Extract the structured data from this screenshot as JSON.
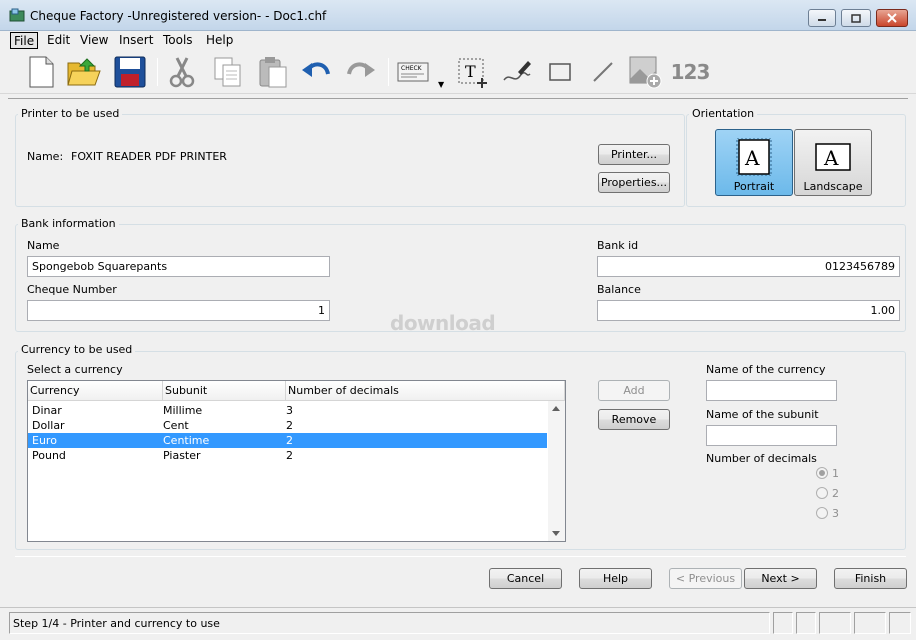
{
  "window": {
    "title": "Cheque Factory -Unregistered version- - Doc1.chf"
  },
  "menu": {
    "items": [
      "File",
      "Edit",
      "View",
      "Insert",
      "Tools",
      "Help"
    ]
  },
  "toolbar": {
    "buttons": [
      "new-icon",
      "open-icon",
      "save-icon",
      "cut-icon",
      "copy-icon",
      "paste-icon",
      "undo-icon",
      "redo-icon",
      "cheque-icon",
      "text-tool-icon",
      "signature-icon",
      "rectangle-icon",
      "line-icon",
      "image-icon",
      "number-icon"
    ],
    "cheque_icon_text": "CHECK",
    "number_icon_text": "123"
  },
  "printer": {
    "group_label": "Printer to be used",
    "name_label": "Name:",
    "name_value": "FOXIT READER PDF PRINTER",
    "printer_button": "Printer...",
    "properties_button": "Properties..."
  },
  "orientation": {
    "group_label": "Orientation",
    "portrait_label": "Portrait",
    "landscape_label": "Landscape",
    "icon_letter": "A",
    "selected": "Portrait"
  },
  "bank": {
    "group_label": "Bank information",
    "name_label": "Name",
    "name_value": "Spongebob Squarepants",
    "cheque_number_label": "Cheque Number",
    "cheque_number_value": "1",
    "bank_id_label": "Bank id",
    "bank_id_value": "0123456789",
    "balance_label": "Balance",
    "balance_value": "1.00"
  },
  "watermark": "download",
  "currency": {
    "group_label": "Currency to be used",
    "select_label": "Select a currency",
    "columns": [
      "Currency",
      "Subunit",
      "Number of decimals"
    ],
    "rows": [
      {
        "currency": "Dinar",
        "subunit": "Millime",
        "decimals": "3",
        "selected": false
      },
      {
        "currency": "Dollar",
        "subunit": "Cent",
        "decimals": "2",
        "selected": false
      },
      {
        "currency": "Euro",
        "subunit": "Centime",
        "decimals": "2",
        "selected": true
      },
      {
        "currency": "Pound",
        "subunit": "Piaster",
        "decimals": "2",
        "selected": false
      }
    ],
    "add_button": "Add",
    "remove_button": "Remove",
    "currency_name_label": "Name of the currency",
    "currency_name_value": "",
    "subunit_name_label": "Name of the subunit",
    "subunit_name_value": "",
    "decimals_label": "Number of decimals",
    "decimal_options": [
      "1",
      "2",
      "3"
    ],
    "decimal_selected": "1"
  },
  "wizard": {
    "cancel": "Cancel",
    "help": "Help",
    "previous": "< Previous",
    "next": "Next >",
    "finish": "Finish"
  },
  "status": {
    "text": "Step 1/4 - Printer and currency to use"
  }
}
